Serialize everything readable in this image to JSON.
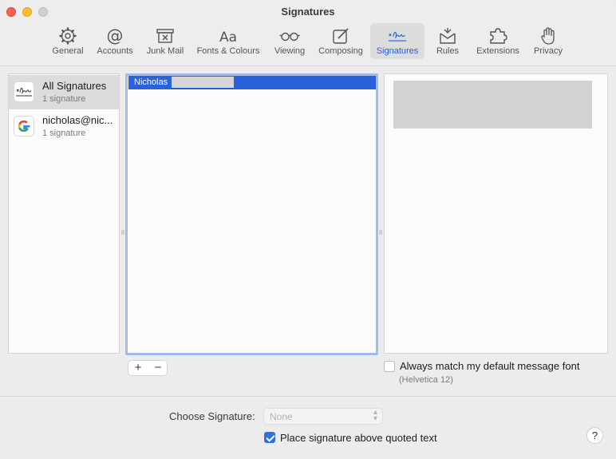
{
  "window": {
    "title": "Signatures"
  },
  "toolbar": {
    "items": [
      {
        "label": "General",
        "icon": "gear-icon",
        "active": false
      },
      {
        "label": "Accounts",
        "icon": "at-icon",
        "active": false
      },
      {
        "label": "Junk Mail",
        "icon": "junk-mail-icon",
        "active": false
      },
      {
        "label": "Fonts & Colours",
        "icon": "fonts-icon",
        "active": false
      },
      {
        "label": "Viewing",
        "icon": "glasses-icon",
        "active": false
      },
      {
        "label": "Composing",
        "icon": "compose-icon",
        "active": false
      },
      {
        "label": "Signatures",
        "icon": "signature-icon",
        "active": true
      },
      {
        "label": "Rules",
        "icon": "rules-icon",
        "active": false
      },
      {
        "label": "Extensions",
        "icon": "puzzle-icon",
        "active": false
      },
      {
        "label": "Privacy",
        "icon": "hand-icon",
        "active": false
      }
    ],
    "fonts_glyph": "Aa"
  },
  "accounts": [
    {
      "name": "All Signatures",
      "sub": "1 signature",
      "icon": "signature-icon",
      "selected": true
    },
    {
      "name": "nicholas@nic...",
      "sub": "1 signature",
      "icon": "google-icon",
      "selected": false
    }
  ],
  "signatures": [
    {
      "name": "Nicholas",
      "selected": true
    }
  ],
  "buttons": {
    "add": "+",
    "remove": "−",
    "help": "?"
  },
  "options": {
    "always_match_label": "Always match my default message font",
    "always_match_note": "(Helvetica 12)",
    "always_match_checked": false,
    "choose_signature_label": "Choose Signature:",
    "choose_signature_value": "None",
    "place_above_label": "Place signature above quoted text",
    "place_above_checked": true
  },
  "colors": {
    "accent": "#2a62d8",
    "checkbox": "#2f6fe0"
  }
}
